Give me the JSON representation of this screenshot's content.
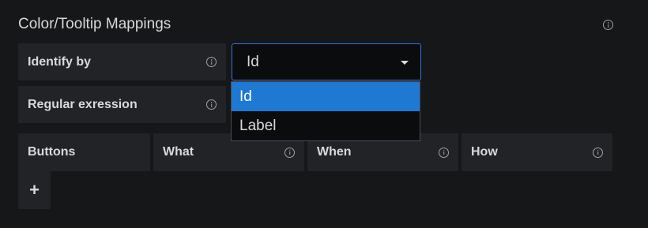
{
  "section": {
    "title": "Color/Tooltip Mappings"
  },
  "identify_by": {
    "label": "Identify by",
    "selected_value": "Id",
    "options": [
      "Id",
      "Label"
    ]
  },
  "regular_expression": {
    "label": "Regular exression"
  },
  "columns": {
    "buttons": "Buttons",
    "what": "What",
    "when": "When",
    "how": "How"
  },
  "add_button": {
    "label": "+"
  }
}
